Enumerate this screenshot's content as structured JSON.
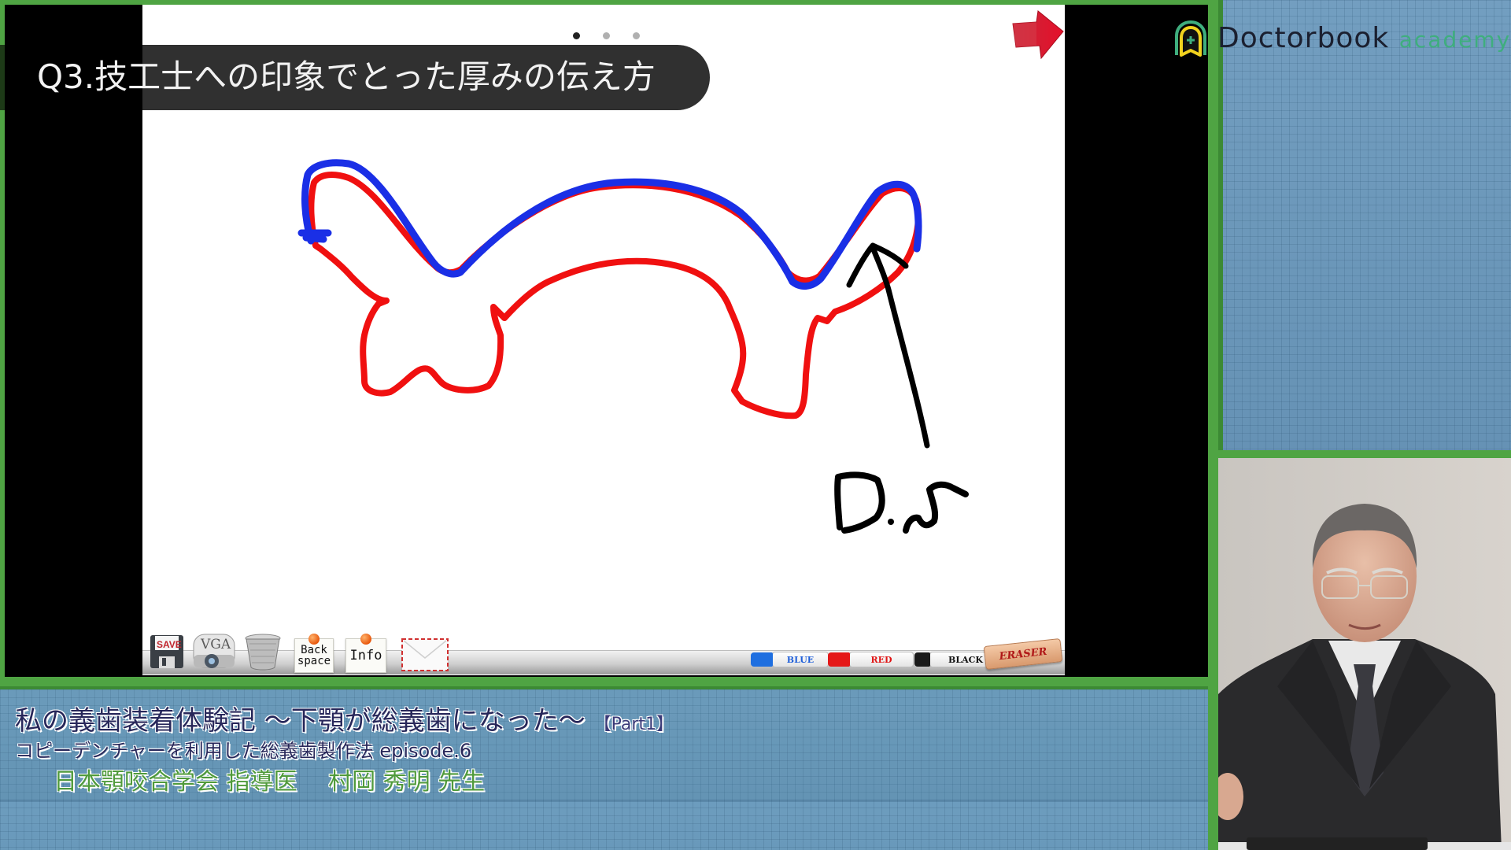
{
  "slide": {
    "title": "Q3.技工士への印象でとった厚みの伝え方",
    "pager": {
      "total": 3,
      "current": 1
    },
    "next_arrow": "next-arrow-icon",
    "annotation_label": "D.S",
    "drawing": {
      "strokes": [
        {
          "name": "blue-outline-stroke",
          "color": "#1a2fe6"
        },
        {
          "name": "red-outline-stroke",
          "color": "#f01010"
        },
        {
          "name": "black-arrow-stroke",
          "color": "#000000"
        }
      ]
    }
  },
  "toolbar": {
    "save": "SAVE",
    "vga": "VGA",
    "trash": "trash-icon",
    "backspace_line1": "Back",
    "backspace_line2": "space",
    "info": "Info",
    "mail": "mail-icon",
    "pens": [
      {
        "label": "BLUE",
        "color": "#1f5fd9"
      },
      {
        "label": "RED",
        "color": "#e01515"
      },
      {
        "label": "BLACK",
        "color": "#111111"
      }
    ],
    "eraser": "ERASER"
  },
  "caption": {
    "title": "私の義歯装着体験記 ～下顎が総義歯になった～",
    "part": "【Part1】",
    "subtitle": "コピーデンチャーを利用した総義歯製作法 episode.6",
    "speaker": "日本顎咬合学会 指導医　 村岡 秀明 先生"
  },
  "brand": {
    "name": "Doctorbook",
    "suffix": "academy",
    "colors": {
      "frame_green": "#4fa443",
      "academy_green": "#3fae7e",
      "logo_yellow": "#f1d21e"
    }
  }
}
